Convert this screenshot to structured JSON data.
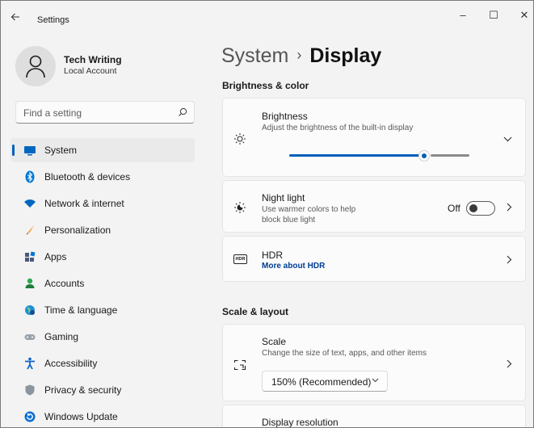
{
  "window": {
    "title": "Settings",
    "back_icon": "arrow-left-icon",
    "minimize": "–",
    "maximize": "☐",
    "close": "✕"
  },
  "profile": {
    "name": "Tech Writing",
    "account_type": "Local Account"
  },
  "search": {
    "placeholder": "Find a setting"
  },
  "sidebar": {
    "items": [
      {
        "label": "System",
        "icon": "monitor-icon",
        "active": true
      },
      {
        "label": "Bluetooth & devices",
        "icon": "bluetooth-icon"
      },
      {
        "label": "Network & internet",
        "icon": "wifi-icon"
      },
      {
        "label": "Personalization",
        "icon": "brush-icon"
      },
      {
        "label": "Apps",
        "icon": "apps-icon"
      },
      {
        "label": "Accounts",
        "icon": "person-icon"
      },
      {
        "label": "Time & language",
        "icon": "globe-clock-icon"
      },
      {
        "label": "Gaming",
        "icon": "gamepad-icon"
      },
      {
        "label": "Accessibility",
        "icon": "accessibility-icon"
      },
      {
        "label": "Privacy & security",
        "icon": "shield-icon"
      },
      {
        "label": "Windows Update",
        "icon": "update-icon"
      }
    ]
  },
  "breadcrumb": {
    "parent": "System",
    "separator": "›",
    "current": "Display"
  },
  "sections": {
    "brightness_color": "Brightness & color",
    "scale_layout": "Scale & layout"
  },
  "brightness": {
    "title": "Brightness",
    "description": "Adjust the brightness of the built-in display",
    "level_percent": 75
  },
  "night_light": {
    "title": "Night light",
    "description": "Use warmer colors to help block blue light",
    "state_label": "Off"
  },
  "hdr": {
    "title": "HDR",
    "link": "More about HDR",
    "badge": "HDR"
  },
  "scale": {
    "title": "Scale",
    "description": "Change the size of text, apps, and other items",
    "selected": "150% (Recommended)"
  },
  "display_resolution": {
    "title": "Display resolution"
  },
  "colors": {
    "accent": "#005fb8",
    "background": "#f3f3f3",
    "card": "#fbfbfb"
  }
}
